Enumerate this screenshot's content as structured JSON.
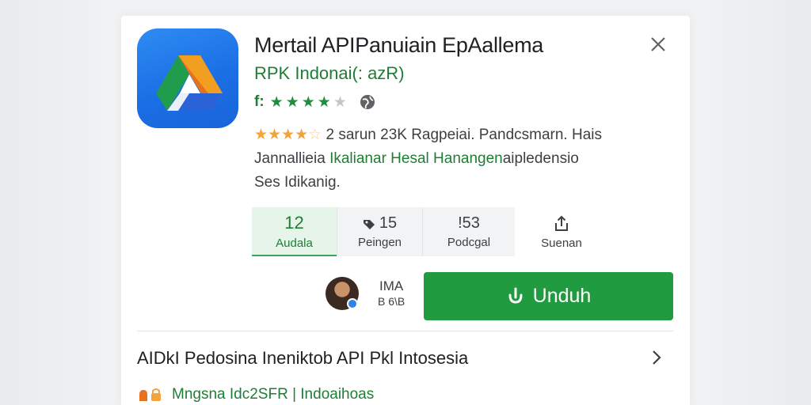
{
  "app": {
    "title": "Mertail APIPanuiain EpAallema",
    "developer": "RPK Indonai(: azR)",
    "meta_prefix": "f:",
    "meta_stars": 4,
    "meta_stars_max": 5
  },
  "description": {
    "rating_text": "2 sarun 23K Ragpeiai. Pandcsmarn. Hais",
    "line2_a": "Jannallieia",
    "line2_green": "Ikalianar Hesal Hanangen",
    "line2_b": "aipledensio",
    "line3": "Ses Idikanig."
  },
  "stats": [
    {
      "value": "12",
      "label": "Audala",
      "icon": ""
    },
    {
      "value": "15",
      "label": "Peingen",
      "icon": "tag-icon"
    },
    {
      "value": "!53",
      "label": "Podcgal",
      "icon": ""
    },
    {
      "value": "",
      "label": "Suenan",
      "icon": "share-icon"
    }
  ],
  "install": {
    "size_top": "IMA",
    "size_bottom": "B 6\\B",
    "button_label": "Unduh"
  },
  "section": {
    "title": "AIDkI Pedosina Ineniktob API Pkl Intosesia"
  },
  "footer": {
    "text": "Mngsna Idc2SFR | Indoaihoas"
  },
  "colors": {
    "accent_green": "#219b3f",
    "text_green": "#1e7e34",
    "icon_blue": "#1b6fe5",
    "star_orange": "#f2a33a"
  }
}
